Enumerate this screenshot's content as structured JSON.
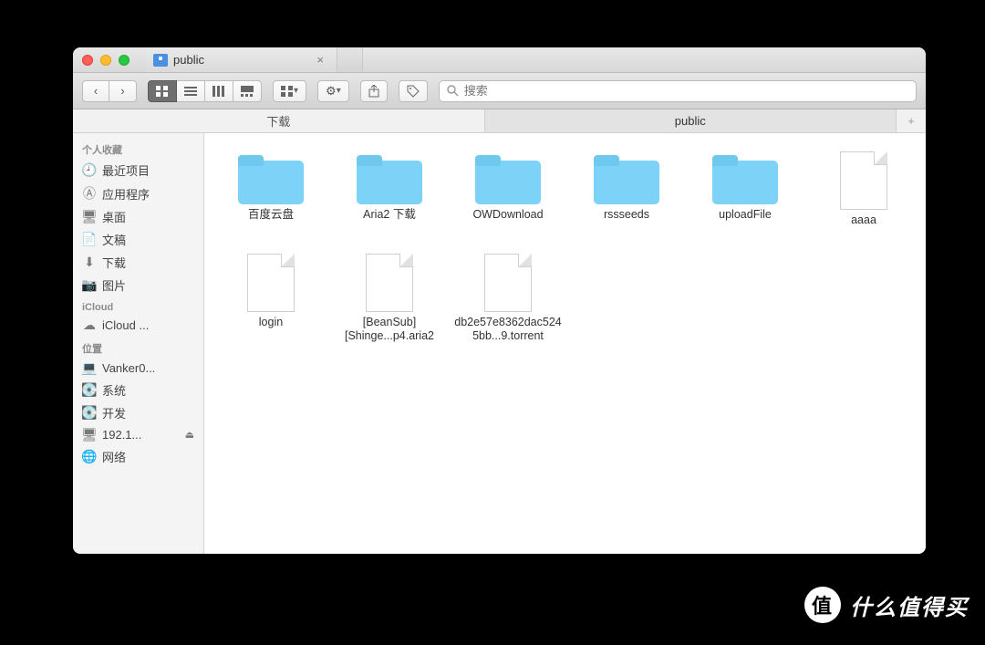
{
  "window": {
    "tab_title": "public"
  },
  "toolbar": {
    "search_placeholder": "搜索"
  },
  "pathbar": {
    "crumbs": [
      "下载",
      "public"
    ],
    "add": "+"
  },
  "sidebar": {
    "sections": [
      {
        "title": "个人收藏",
        "items": [
          {
            "label": "最近项目",
            "icon": "clock"
          },
          {
            "label": "应用程序",
            "icon": "apps"
          },
          {
            "label": "桌面",
            "icon": "desktop"
          },
          {
            "label": "文稿",
            "icon": "doc"
          },
          {
            "label": "下载",
            "icon": "download",
            "selected": false
          },
          {
            "label": "图片",
            "icon": "camera"
          }
        ]
      },
      {
        "title": "iCloud",
        "items": [
          {
            "label": "iCloud ...",
            "icon": "cloud"
          }
        ]
      },
      {
        "title": "位置",
        "items": [
          {
            "label": "Vanker0...",
            "icon": "laptop"
          },
          {
            "label": "系统",
            "icon": "disk"
          },
          {
            "label": "开发",
            "icon": "disk"
          },
          {
            "label": "192.1...",
            "icon": "net",
            "ejectable": true
          }
        ]
      },
      {
        "title": "",
        "items": [
          {
            "label": "网络",
            "icon": "globe"
          }
        ]
      }
    ]
  },
  "contents": {
    "items": [
      {
        "type": "folder",
        "name": "百度云盘"
      },
      {
        "type": "folder",
        "name": "Aria2 下载"
      },
      {
        "type": "folder",
        "name": "OWDownload"
      },
      {
        "type": "folder",
        "name": "rssseeds"
      },
      {
        "type": "folder",
        "name": "uploadFile"
      },
      {
        "type": "file",
        "name": "aaaa"
      },
      {
        "type": "file",
        "name": "login"
      },
      {
        "type": "file",
        "name": "[BeanSub][Shinge...p4.aria2"
      },
      {
        "type": "file",
        "name": "db2e57e8362dac5245bb...9.torrent"
      }
    ]
  },
  "watermark": {
    "char": "值",
    "text": "什么值得买"
  }
}
